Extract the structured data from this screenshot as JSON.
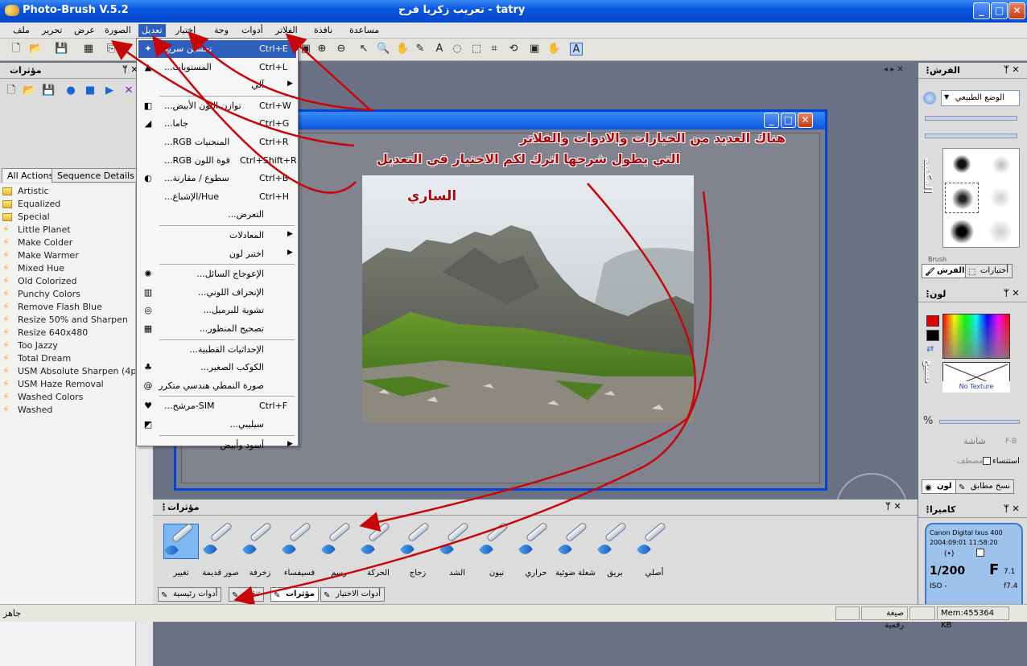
{
  "window": {
    "title": "Photo-Brush V.5.2",
    "subtitle": "tatry - تعريب زكريا فرح",
    "min": "_",
    "max": "□",
    "close": "✕"
  },
  "menu": {
    "file": "ملف",
    "edit": "تحرير",
    "view": "عرض",
    "image": "الصورة",
    "adjust": "تعديل",
    "select": "إختيار",
    "face": "وجة",
    "tools": "أدوات",
    "filters": "الفلاتر",
    "window": "نافذة",
    "help": "مساعدة"
  },
  "left_panel": {
    "title": "مؤثرات",
    "pin": "ᛘ ✕",
    "tabs": [
      "All Actions",
      "Sequence Details"
    ],
    "actions": [
      {
        "label": "Artistic",
        "icon": "folder-icon"
      },
      {
        "label": "Equalized",
        "icon": "folder-icon"
      },
      {
        "label": "Special",
        "icon": "folder-icon"
      },
      {
        "label": "Little Planet",
        "icon": "lightning-icon"
      },
      {
        "label": "Make Colder",
        "icon": "lightning-icon"
      },
      {
        "label": "Make Warmer",
        "icon": "lightning-icon"
      },
      {
        "label": "Mixed Hue",
        "icon": "lightning-icon"
      },
      {
        "label": "Old Colorized",
        "icon": "lightning-icon"
      },
      {
        "label": "Punchy Colors",
        "icon": "lightning-icon"
      },
      {
        "label": "Remove Flash Blue",
        "icon": "lightning-icon"
      },
      {
        "label": "Resize 50% and Sharpen",
        "icon": "lightning-icon"
      },
      {
        "label": "Resize 640x480",
        "icon": "lightning-icon"
      },
      {
        "label": "Too Jazzy",
        "icon": "lightning-icon"
      },
      {
        "label": "Total Dream",
        "icon": "lightning-icon"
      },
      {
        "label": "USM Absolute Sharpen (4pass",
        "icon": "lightning-icon"
      },
      {
        "label": "USM Haze Removal",
        "icon": "lightning-icon"
      },
      {
        "label": "Washed Colors",
        "icon": "lightning-icon"
      },
      {
        "label": "Washed",
        "icon": "lightning-icon"
      }
    ]
  },
  "adjust_menu": [
    {
      "label": "تحسين سريع",
      "shortcut": "Ctrl+E",
      "icon": "wand-icon"
    },
    {
      "label": "المستويات...",
      "shortcut": "Ctrl+L",
      "icon": "levels-icon"
    },
    {
      "label": "آلي",
      "submenu": true
    },
    {
      "label": "توازن اللون الأبيض...",
      "shortcut": "Ctrl+W",
      "icon": "white-balance-icon"
    },
    {
      "label": "جاما...",
      "shortcut": "Ctrl+G",
      "icon": "gamma-icon"
    },
    {
      "label": "المنحنيات RGB...",
      "shortcut": "Ctrl+R"
    },
    {
      "label": "قوة اللون RGB...",
      "shortcut": "Ctrl+Shift+R"
    },
    {
      "label": "سطوع / مقارنة...",
      "shortcut": "Ctrl+B",
      "icon": "contrast-icon"
    },
    {
      "label": "Hue/الإشباع...",
      "shortcut": "Ctrl+H"
    },
    {
      "label": "التعرض..."
    },
    {
      "label": "المعادلات",
      "submenu": true
    },
    {
      "label": "اختبر لون",
      "submenu": true
    },
    {
      "label": "الإعوجاج السائل...",
      "icon": "liquify-icon"
    },
    {
      "label": "الإنحراف اللوني...",
      "icon": "chromatic-icon"
    },
    {
      "label": "تشوية للبرميل...",
      "icon": "barrel-icon"
    },
    {
      "label": "تصحيح المنظور...",
      "icon": "perspective-icon"
    },
    {
      "label": "الإحداثيات القطبية..."
    },
    {
      "label": "الكوكب الصغير...",
      "icon": "planet-icon"
    },
    {
      "label": "صورة النمطي هندسي متكرر",
      "icon": "spiral-icon"
    },
    {
      "label": "SIM-مرشح...",
      "shortcut": "Ctrl+F",
      "icon": "sim-icon"
    },
    {
      "label": "سيليبي...",
      "icon": "bw-icon"
    },
    {
      "label": "أسود وأبيض",
      "submenu": true
    }
  ],
  "annotations": {
    "line1": "هناك العديد من الخيارات والادوات والفلاتر",
    "line2": "التي يطول شرحها اترك لكم الاختيار في التعديل",
    "photo_label": "الساري"
  },
  "right_panel": {
    "brushes": {
      "title": "الفرش",
      "mode": "الوضع الطبيعي",
      "tab_brush": "الفرش",
      "tab_options": "أختيارات",
      "vertical_label": "المكتبة",
      "brush_caption": "Brush"
    },
    "color": {
      "title": "لون",
      "texture": "No Texture",
      "percent": "%",
      "screen": "شاشة",
      "fb": "F-B",
      "flat": "مصطف",
      "antialias": "استنساء",
      "tab_color": "لون",
      "tab_clone": "نسخ مطابق",
      "vertical_label": "نسيج"
    },
    "camera": {
      "title": "كاميرا",
      "model": "Canon Digital Ixus 400",
      "date": "2004:09:01 11:58:20",
      "shutter": "1/200",
      "fnum": "F",
      "fval": "7.1",
      "iso": "ISO -",
      "focal": "f7.4"
    }
  },
  "bottom_panel": {
    "title": "مؤثرات",
    "effects": [
      "تغيير",
      "صور قديمة",
      "زخرفة",
      "فسيفساء",
      "رسم",
      "الحركة",
      "زجاج",
      "الشد",
      "نيون",
      "حراري",
      "شعلة ضوئية",
      "بريق",
      "أصلي"
    ],
    "tabs": [
      "أدوات رئيسية",
      "تنقيح",
      "مؤثرات",
      "أدوات الاختيار"
    ]
  },
  "status": {
    "ready": "جاهز",
    "mode": "صيغة رقمية",
    "mem": "Mem:455364 KB"
  }
}
